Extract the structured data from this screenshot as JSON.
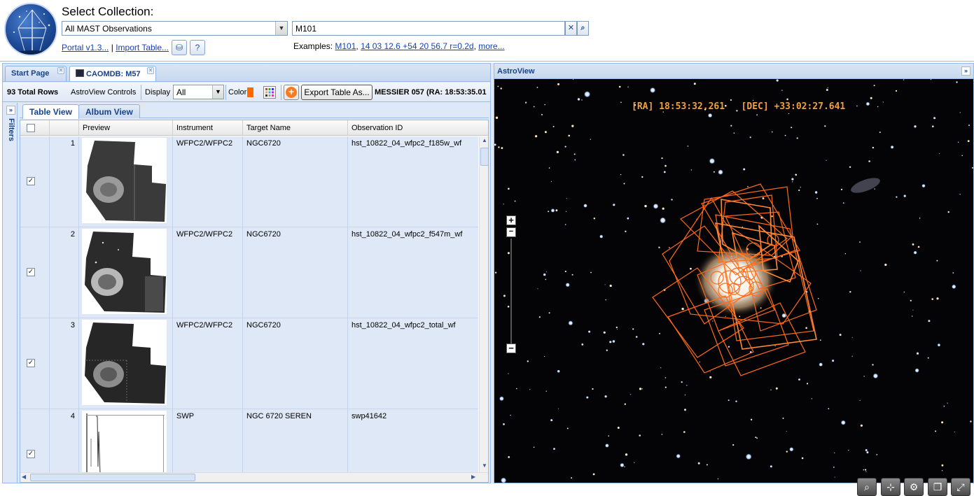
{
  "header": {
    "title": "Select Collection:",
    "collection_value": "All MAST Observations",
    "search_value": "M101",
    "links": {
      "portal": "Portal v1.3...",
      "separator": "|",
      "import": "Import Table..."
    },
    "examples": {
      "label": "Examples:",
      "ex1": "M101",
      "ex2": "14 03 12.6 +54 20 56.7 r=0.2d",
      "more": "more..."
    }
  },
  "tabs": [
    {
      "label": "Start Page"
    },
    {
      "label": "CAOMDB: M57"
    }
  ],
  "toolbar": {
    "total_rows": "93 Total Rows",
    "astroview_controls": "AstroView Controls",
    "display_label": "Display",
    "display_value": "All",
    "color_label": "Color",
    "export_label": "Export Table As...",
    "target_info": "MESSIER 057 (RA: 18:53:35.01"
  },
  "filters": {
    "label": "Filters"
  },
  "views": {
    "table": "Table View",
    "album": "Album View"
  },
  "grid": {
    "columns": [
      "Preview",
      "Instrument",
      "Target Name",
      "Observation ID"
    ],
    "rows": [
      {
        "num": "1",
        "instrument": "WFPC2/WFPC2",
        "target": "NGC6720",
        "obs_id": "hst_10822_04_wfpc2_f185w_wf"
      },
      {
        "num": "2",
        "instrument": "WFPC2/WFPC2",
        "target": "NGC6720",
        "obs_id": "hst_10822_04_wfpc2_f547m_wf"
      },
      {
        "num": "3",
        "instrument": "WFPC2/WFPC2",
        "target": "NGC6720",
        "obs_id": "hst_10822_04_wfpc2_total_wf"
      },
      {
        "num": "4",
        "instrument": "SWP",
        "target": "NGC 6720 SEREN",
        "obs_id": "swp41642"
      }
    ]
  },
  "astroview": {
    "title": "AstroView",
    "ra": "[RA] 18:53:32.261",
    "dec": "[DEC] +33:02:27.641"
  },
  "colors": {
    "accent": "#15428b",
    "panel": "#dfe8f6",
    "footprint": "#ff6a1a",
    "coords": "#f0a040"
  }
}
